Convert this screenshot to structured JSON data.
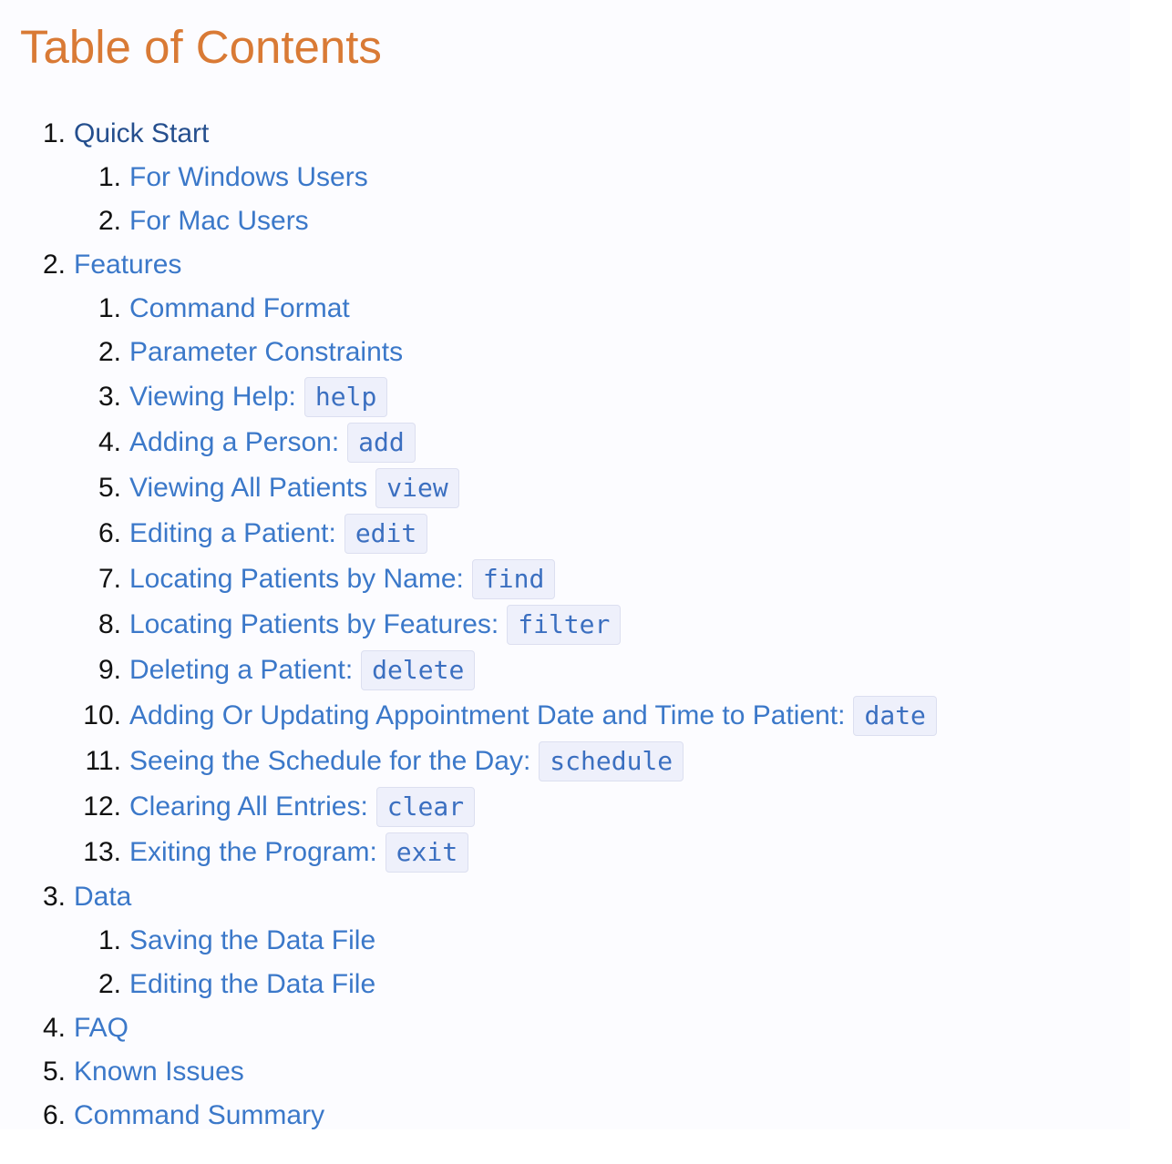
{
  "title": "Table of Contents",
  "toc": [
    {
      "num": "1.",
      "label": "Quick Start",
      "children": [
        {
          "num": "1.",
          "label": "For Windows Users",
          "code": ""
        },
        {
          "num": "2.",
          "label": "For Mac Users",
          "code": ""
        }
      ]
    },
    {
      "num": "2.",
      "label": "Features",
      "children": [
        {
          "num": "1.",
          "label": "Command Format",
          "code": ""
        },
        {
          "num": "2.",
          "label": "Parameter Constraints",
          "code": ""
        },
        {
          "num": "3.",
          "label": "Viewing Help:",
          "code": "help"
        },
        {
          "num": "4.",
          "label": "Adding a Person:",
          "code": "add"
        },
        {
          "num": "5.",
          "label": "Viewing All Patients",
          "code": "view"
        },
        {
          "num": "6.",
          "label": "Editing a Patient:",
          "code": "edit"
        },
        {
          "num": "7.",
          "label": "Locating Patients by Name:",
          "code": "find"
        },
        {
          "num": "8.",
          "label": "Locating Patients by Features:",
          "code": "filter"
        },
        {
          "num": "9.",
          "label": "Deleting a Patient:",
          "code": "delete"
        },
        {
          "num": "10.",
          "label": "Adding Or Updating Appointment Date and Time to Patient:",
          "code": "date"
        },
        {
          "num": "11.",
          "label": "Seeing the Schedule for the Day:",
          "code": "schedule"
        },
        {
          "num": "12.",
          "label": "Clearing All Entries:",
          "code": "clear"
        },
        {
          "num": "13.",
          "label": "Exiting the Program:",
          "code": "exit"
        }
      ]
    },
    {
      "num": "3.",
      "label": "Data",
      "children": [
        {
          "num": "1.",
          "label": "Saving the Data File",
          "code": ""
        },
        {
          "num": "2.",
          "label": "Editing the Data File",
          "code": ""
        }
      ]
    },
    {
      "num": "4.",
      "label": "FAQ",
      "children": []
    },
    {
      "num": "5.",
      "label": "Known Issues",
      "children": []
    },
    {
      "num": "6.",
      "label": "Command Summary",
      "children": []
    }
  ],
  "colors": {
    "title": "#d97a35",
    "link": "#3b78c9",
    "visited_link": "#254f8e",
    "code_text": "#3b6fc0",
    "code_bg": "#eef0fb"
  }
}
